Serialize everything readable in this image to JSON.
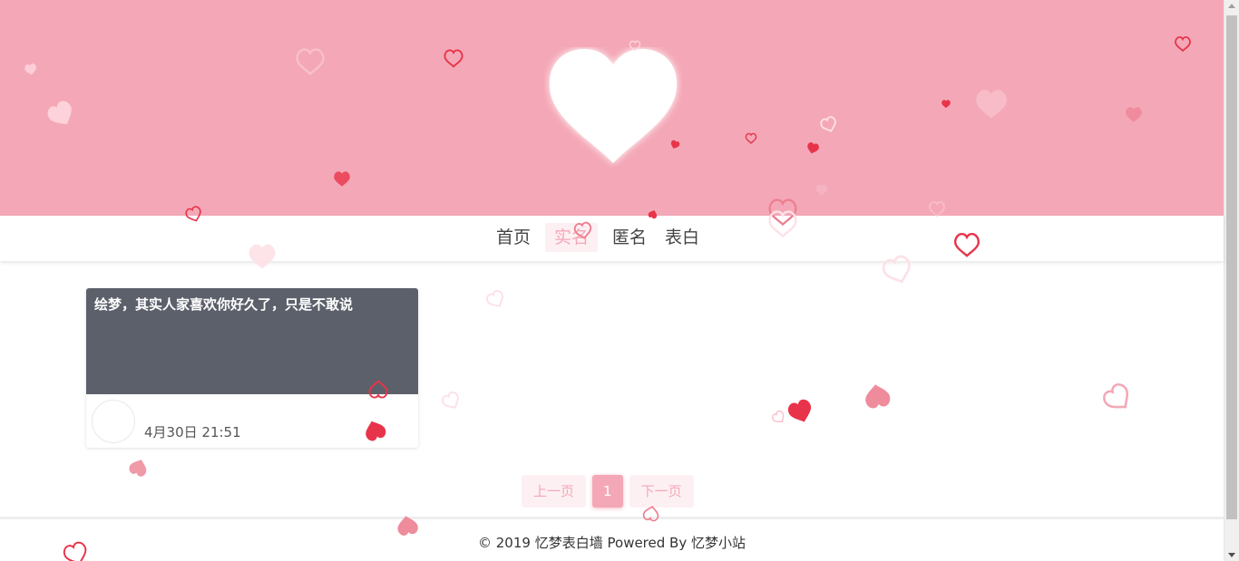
{
  "nav": {
    "items": [
      {
        "label": "首页"
      },
      {
        "label": "实名"
      },
      {
        "label": "匿名"
      },
      {
        "label": "表白"
      }
    ],
    "active": "实名"
  },
  "card": {
    "message": "绘梦，其实人家喜欢你好久了，只是不敢说",
    "time": "4月30日 21:51"
  },
  "pagination": {
    "prev": "上一页",
    "current": "1",
    "next": "下一页"
  },
  "footer": {
    "copyright": "© 2019",
    "site_name": "忆梦表白墙",
    "powered_by": "Powered By",
    "powered_site": "忆梦小站"
  },
  "colors": {
    "banner": "#f4a8b7",
    "card_body": "#5c606b",
    "accent": "#f4a8b7",
    "heart_red": "#e8344a"
  },
  "icons": {
    "logo": "heart-icon",
    "decorations": "floating-heart-icons"
  }
}
